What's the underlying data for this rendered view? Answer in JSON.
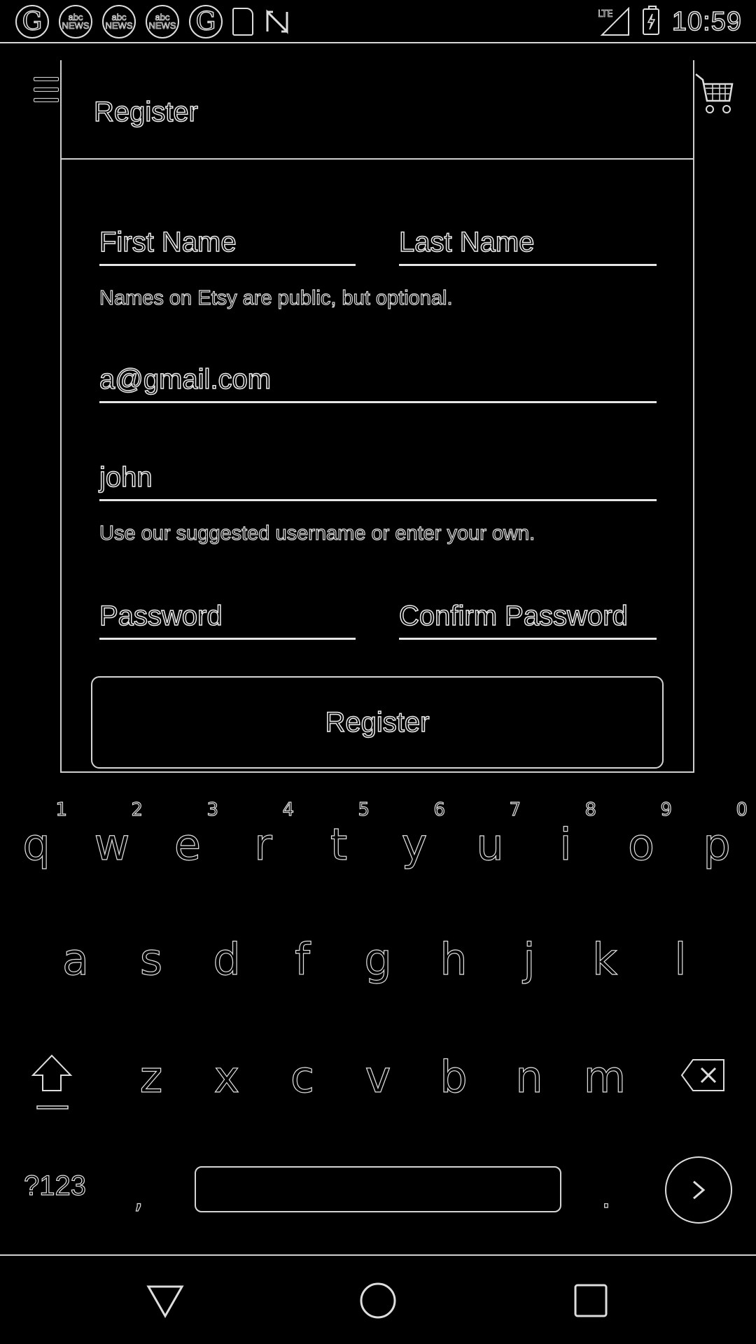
{
  "status_bar": {
    "time": "10:59",
    "notifications": [
      {
        "icon": "g-news-icon",
        "label": "G"
      },
      {
        "icon": "abc-news-icon",
        "label": "abc NEWS"
      },
      {
        "icon": "abc-news-icon",
        "label": "abc NEWS"
      },
      {
        "icon": "abc-news-icon",
        "label": "abc NEWS"
      },
      {
        "icon": "g-news-icon",
        "label": "G"
      },
      {
        "icon": "sd-card-icon",
        "label": ""
      },
      {
        "icon": "n-notification-icon",
        "label": ""
      }
    ],
    "network": "LTE"
  },
  "dialog": {
    "title": "Register",
    "first_name_placeholder": "First Name",
    "last_name_placeholder": "Last Name",
    "names_helper": "Names on Etsy are public, but optional.",
    "email_value": "a@gmail.com",
    "username_value": "john",
    "username_helper": "Use our suggested username or enter your own.",
    "password_placeholder": "Password",
    "confirm_password_placeholder": "Confirm Password",
    "register_button": "Register"
  },
  "keyboard": {
    "row1": [
      {
        "key": "q",
        "hint": "1"
      },
      {
        "key": "w",
        "hint": "2"
      },
      {
        "key": "e",
        "hint": "3"
      },
      {
        "key": "r",
        "hint": "4"
      },
      {
        "key": "t",
        "hint": "5"
      },
      {
        "key": "y",
        "hint": "6"
      },
      {
        "key": "u",
        "hint": "7"
      },
      {
        "key": "i",
        "hint": "8"
      },
      {
        "key": "o",
        "hint": "9"
      },
      {
        "key": "p",
        "hint": "0"
      }
    ],
    "row2": [
      "a",
      "s",
      "d",
      "f",
      "g",
      "h",
      "j",
      "k",
      "l"
    ],
    "row3": [
      "z",
      "x",
      "c",
      "v",
      "b",
      "n",
      "m"
    ],
    "symbols_label": "?123",
    "comma": ",",
    "period": "."
  },
  "colors": {
    "background": "#000000",
    "line": "#e0e0e0"
  }
}
